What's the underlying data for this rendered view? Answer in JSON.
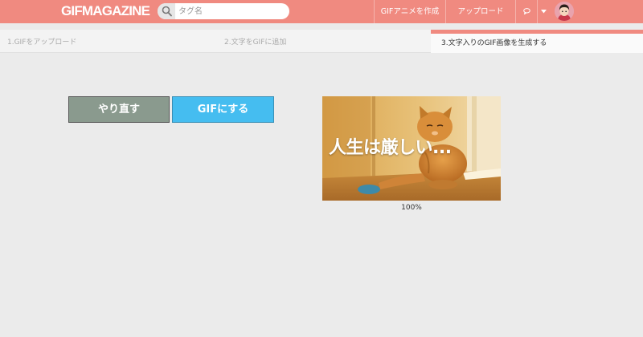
{
  "header": {
    "logo": "GIFMAGAZINE",
    "search": {
      "placeholder": "タグ名",
      "value": ""
    },
    "nav": {
      "create_label": "GIFアニメを作成",
      "upload_label": "アップロード"
    }
  },
  "steps": [
    {
      "label": "1.GIFをアップロード",
      "active": false
    },
    {
      "label": "2.文字をGIFに追加",
      "active": false
    },
    {
      "label": "3.文字入りのGIF画像を生成する",
      "active": true
    }
  ],
  "actions": {
    "redo_label": "やり直す",
    "make_gif_label": "GIFにする"
  },
  "preview": {
    "caption": "人生は厳しい...",
    "progress_label": "100%",
    "progress": 1.0
  },
  "colors": {
    "brand": "#f08a80",
    "redo_button": "#8a9a8e",
    "gif_button": "#45bdf0"
  },
  "icons": {
    "search": "search-icon",
    "comment": "speech-bubble-icon",
    "dropdown": "caret-down-icon"
  }
}
